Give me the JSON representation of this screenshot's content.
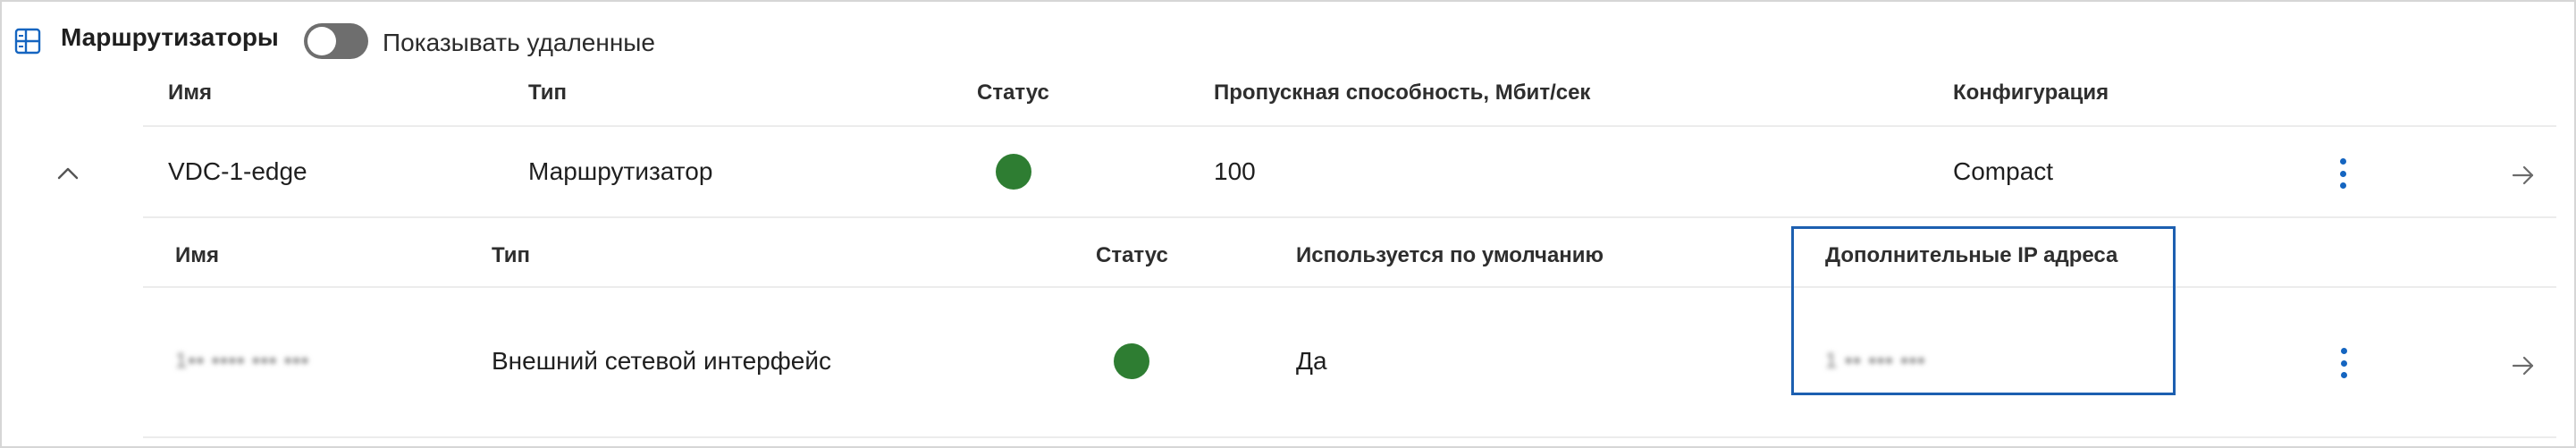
{
  "header": {
    "icon": "table-layout-icon",
    "title": "Маршрутизаторы",
    "toggle_label": "Показывать удаленные",
    "toggle_on": false
  },
  "routers_table": {
    "columns": [
      "Имя",
      "Тип",
      "Статус",
      "Пропускная способность, Мбит/сек",
      "Конфигурация"
    ],
    "rows": [
      {
        "expanded": true,
        "name": "VDC-1-edge",
        "type": "Маршрутизатор",
        "status_color": "#2e7d32",
        "bandwidth": "100",
        "configuration": "Compact"
      }
    ]
  },
  "interfaces_table": {
    "columns": [
      "Имя",
      "Тип",
      "Статус",
      "Используется по умолчанию",
      "Дополнительные IP адреса"
    ],
    "rows": [
      {
        "name": "1•• •••• ••• •••",
        "type": "Внешний сетевой интерфейс",
        "status_color": "#2e7d32",
        "default": "Да",
        "extra_ip": "1 •• ••• •••"
      }
    ]
  },
  "colors": {
    "accent": "#1565c0",
    "highlight_border": "#1d5fb0",
    "status_ok": "#2e7d32",
    "toggle_off": "#6e6e6e"
  }
}
